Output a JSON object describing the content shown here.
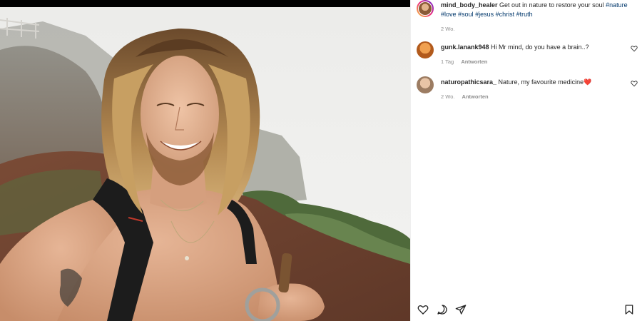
{
  "post": {
    "username": "mind_body_healer",
    "caption_text": "Get out in nature to restore your soul",
    "hashtags": [
      "#nature",
      "#love",
      "#soul",
      "#jesus",
      "#christ",
      "#truth"
    ],
    "time": "2 Wo."
  },
  "comments": [
    {
      "username": "gunk.lanank948",
      "text": "Hi Mr mind, do you have a brain..?",
      "time": "1 Tag",
      "reply": "Antworten"
    },
    {
      "username": "naturopathicsara_",
      "text": "Nature, my favourite medicine",
      "emoji": "❤️",
      "time": "2 Wo.",
      "reply": "Antworten"
    }
  ],
  "icons": {
    "like": "heart-icon",
    "comment": "comment-icon",
    "share": "share-icon",
    "save": "bookmark-icon",
    "comment_like": "heart-icon"
  },
  "colors": {
    "hashtag": "#00376b",
    "meta": "#8e8e8e",
    "text": "#262626",
    "emoji_heart": "#e0245e"
  }
}
